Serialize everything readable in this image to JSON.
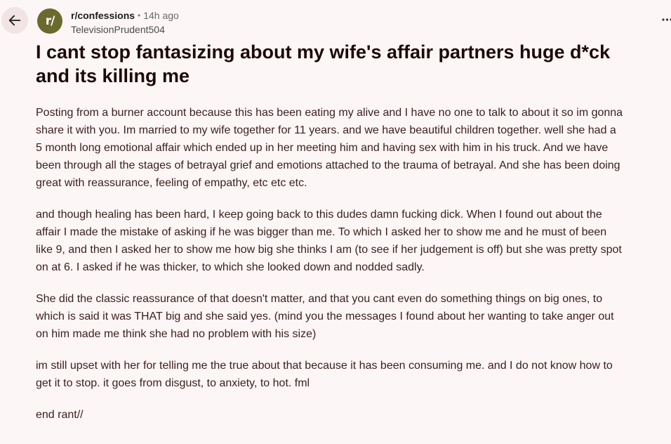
{
  "header": {
    "subreddit": "r/confessions",
    "separator": "•",
    "time_ago": "14h ago",
    "author": "TelevisionPrudent504",
    "avatar_text": "r/"
  },
  "post": {
    "title_line1": "I cant stop fantasizing about my wife's affair partners huge d*ck",
    "title_line2": "and its killing me",
    "paragraphs": [
      [
        "Posting from a burner account because this has been eating my alive and I have no one to talk to about it so im gonna",
        "share it with you. Im married to my wife together for 11 years. and we have beautiful children together. well she had a",
        "5 month long emotional affair which ended up in her meeting him and having sex with him in his truck. And we have",
        "been through all the stages of betrayal grief and emotions attached to the trauma of betrayal. And she has been doing",
        "great with reassurance, feeling of empathy, etc etc etc."
      ],
      [
        "and though healing has been hard, I keep going back to this dudes damn fucking dick. When I found out about the",
        "affair I made the mistake of asking if he was bigger than me. To which I asked her to show me and he must of been",
        "like 9, and then I asked her to show me how big she thinks I am (to see if her judgement is off) but she was pretty spot",
        "on at 6. I asked if he was thicker, to which she looked down and nodded sadly."
      ],
      [
        "She did the classic reassurance of that doesn't matter, and that you cant even do something things on big ones, to",
        "which is said it was THAT big and she said yes. (mind you the messages I found about her wanting to take anger out",
        "on him made me think she had no problem with his size)"
      ],
      [
        "im still upset with her for telling me the true about that because it has been consuming me. and I do not know how to",
        "get it to stop. it goes from disgust, to anxiety, to hot. fml"
      ],
      [
        "end rant//"
      ]
    ]
  },
  "icons": {
    "back": "arrow-left-icon",
    "more": "more-horizontal-icon"
  },
  "colors": {
    "background": "#fdf6f6",
    "avatar": "#6b6a2e",
    "back_button": "#f1e4e4"
  }
}
